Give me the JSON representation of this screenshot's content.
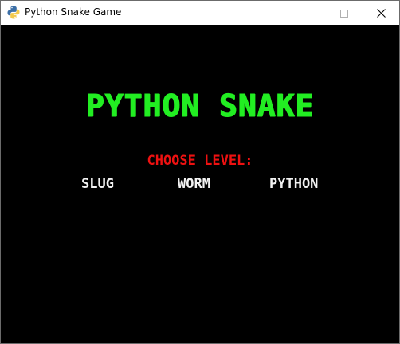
{
  "window": {
    "title": "Python Snake Game",
    "icon": "python-logo-icon",
    "controls": [
      "minimize-icon",
      "maximize-icon",
      "close-icon"
    ]
  },
  "game": {
    "title": "PYTHON SNAKE",
    "prompt": "CHOOSE LEVEL:",
    "levels": [
      {
        "label": "SLUG"
      },
      {
        "label": "WORM"
      },
      {
        "label": "PYTHON"
      }
    ]
  },
  "colors": {
    "background": "#000000",
    "title": "#22ee22",
    "prompt": "#ee1111",
    "levels": "#f2f2f2"
  }
}
